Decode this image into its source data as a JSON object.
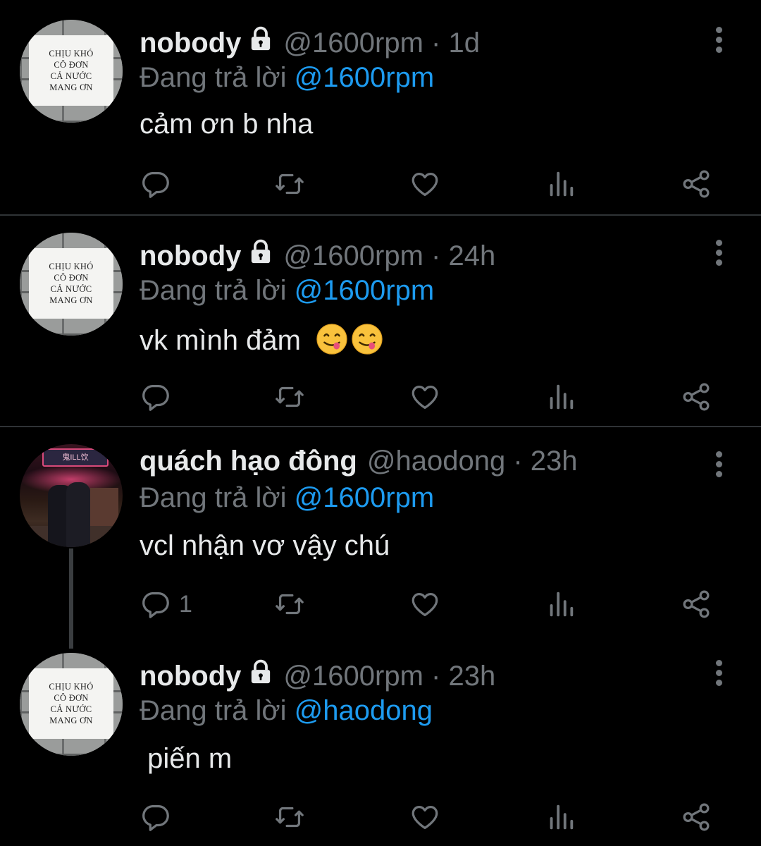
{
  "colors": {
    "background": "#000000",
    "text": "#e7e9ea",
    "muted": "#71767b",
    "link": "#1d9bf0",
    "divider": "#2f3336"
  },
  "avatar_sign_text": [
    "CHỊU KHÓ",
    "CÔ ĐƠN",
    "CẢ NƯỚC",
    "MANG ƠN"
  ],
  "avatar_photo_sign": "鬼ILL饮",
  "tweets": [
    {
      "name": "nobody",
      "handle": "@1600rpm",
      "time": "1d",
      "separator": "·",
      "reply_prefix": "Đang trả lời",
      "reply_to": "@1600rpm",
      "text": "cảm ơn b nha",
      "reply_count": "",
      "protected": true,
      "avatar": "sign"
    },
    {
      "name": "nobody",
      "handle": "@1600rpm",
      "time": "24h",
      "separator": "·",
      "reply_prefix": "Đang trả lời",
      "reply_to": "@1600rpm",
      "text": "vk mình đảm",
      "emoji": [
        "yum-emoji",
        "yum-emoji"
      ],
      "reply_count": "",
      "protected": true,
      "avatar": "sign"
    },
    {
      "name": "quách hạo đông",
      "handle": "@haodong",
      "time": "23h",
      "separator": "·",
      "reply_prefix": "Đang trả lời",
      "reply_to": "@1600rpm",
      "text": "vcl nhận vơ vậy chú",
      "reply_count": "1",
      "protected": false,
      "avatar": "photo"
    },
    {
      "name": "nobody",
      "handle": "@1600rpm",
      "time": "23h",
      "separator": "·",
      "reply_prefix": "Đang trả lời",
      "reply_to": "@haodong",
      "text": " piến m",
      "reply_count": "",
      "protected": true,
      "avatar": "sign"
    }
  ],
  "action_icons": [
    "reply-icon",
    "retweet-icon",
    "like-icon",
    "views-icon",
    "share-icon"
  ]
}
